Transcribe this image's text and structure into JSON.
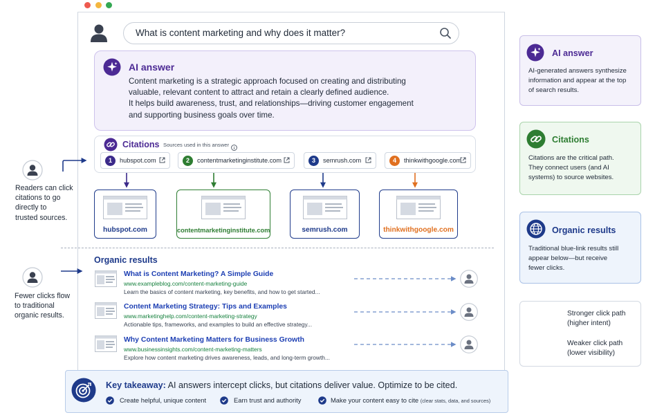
{
  "search": {
    "query": "What is content marketing and why does it matter?"
  },
  "ai_answer": {
    "title": "AI answer",
    "lines": [
      "Content marketing is a strategic approach focused on creating and distributing",
      "valuable, relevant content to attract and retain a clearly defined audience.",
      "It helps build awareness, trust, and relationships—driving customer engagement",
      "and supporting business goals over time."
    ]
  },
  "citations": {
    "title": "Citations",
    "subtitle": "Sources used in this answer",
    "chips": [
      {
        "num": "1",
        "label": "hubspot.com",
        "color": "#3b2a8a"
      },
      {
        "num": "2",
        "label": "contentmarketinginstitute.com",
        "color": "#2e7d32"
      },
      {
        "num": "3",
        "label": "semrush.com",
        "color": "#1e3a8a"
      },
      {
        "num": "4",
        "label": "thinkwithgoogle.com",
        "color": "#e07020"
      }
    ]
  },
  "sites": [
    {
      "label": "hubspot.com",
      "color": "#1e3a8a"
    },
    {
      "label": "contentmarketinginstitute.com",
      "color": "#2e7d32"
    },
    {
      "label": "semrush.com",
      "color": "#1e3a8a"
    },
    {
      "label": "thinkwithgoogle.com",
      "color": "#e07020"
    }
  ],
  "left_notes": {
    "readers": [
      "Readers can click",
      "citations to go",
      "directly to",
      "trusted sources."
    ],
    "fewer": [
      "Fewer clicks flow",
      "to traditional",
      "organic results."
    ]
  },
  "organic": {
    "heading": "Organic results",
    "results": [
      {
        "title": "What is Content Marketing? A Simple Guide",
        "url": "www.exampleblog.com/content-marketing-guide",
        "snippet": "Learn the basics of content marketing, key benefits, and how to get started..."
      },
      {
        "title": "Content Marketing Strategy: Tips and Examples",
        "url": "www.marketinghelp.com/content-marketing-strategy",
        "snippet": "Actionable tips, frameworks, and examples to build an effective strategy..."
      },
      {
        "title": "Why Content Marketing Matters for Business Growth",
        "url": "www.businessinsights.com/content-marketing-matters",
        "snippet": "Explore how content marketing drives awareness, leads, and long-term growth..."
      }
    ]
  },
  "panels": {
    "ai": {
      "title": "AI answer",
      "body": [
        "AI-generated answers synthesize",
        "information and appear at the top",
        "of search results."
      ],
      "accent": "#4c2a94"
    },
    "citations": {
      "title": "Citations",
      "body": [
        "Citations are the critical path.",
        "They connect users (and AI",
        "systems) to source websites."
      ],
      "accent": "#2e7d32"
    },
    "organic": {
      "title": "Organic results",
      "body": [
        "Traditional blue-link results still",
        "appear below—but receive",
        "fewer clicks."
      ],
      "accent": "#1e3a8a"
    }
  },
  "legend": {
    "strong": [
      "Stronger click path",
      "(higher intent)"
    ],
    "weak": [
      "Weaker click path",
      "(lower visibility)"
    ]
  },
  "takeaway": {
    "label": "Key takeaway:",
    "text": " AI answers intercept clicks, but citations deliver value. Optimize to be cited.",
    "items": [
      "Create helpful, unique content",
      "Earn trust and authority",
      "Make your content easy to cite"
    ],
    "note": "(clear stats, data, and sources)"
  }
}
